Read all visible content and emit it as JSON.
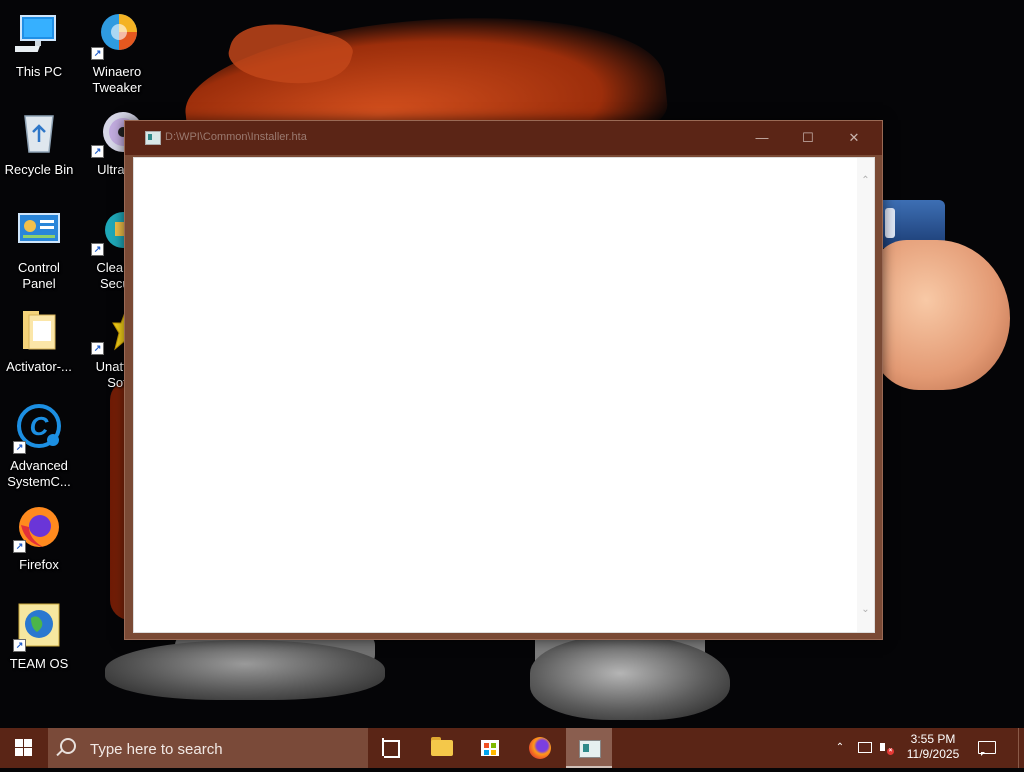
{
  "desktop": {
    "icons": [
      {
        "label_lines": [
          "This PC",
          ""
        ],
        "icon": "computer-icon"
      },
      {
        "label_lines": [
          "Winaero",
          "Tweaker"
        ],
        "icon": "winaero-tweaker-icon"
      },
      {
        "label_lines": [
          "Recycle Bin",
          ""
        ],
        "icon": "recycle-bin-icon"
      },
      {
        "label_lines": [
          "UltraIS",
          ""
        ],
        "icon": "disc-icon"
      },
      {
        "label_lines": [
          "Control",
          "Panel"
        ],
        "icon": "control-panel-icon"
      },
      {
        "label_lines": [
          "Clean I",
          "Secur"
        ],
        "icon": "clean-security-icon"
      },
      {
        "label_lines": [
          "Activator-...",
          ""
        ],
        "icon": "folder-icon"
      },
      {
        "label_lines": [
          "Unatter",
          "Sof"
        ],
        "icon": "star-icon"
      },
      {
        "label_lines": [
          "Advanced",
          "SystemC..."
        ],
        "icon": "advanced-systemcare-icon"
      },
      {
        "label_lines": [
          "Firefox",
          ""
        ],
        "icon": "firefox-icon"
      },
      {
        "label_lines": [
          "TEAM OS",
          ""
        ],
        "icon": "globe-icon"
      }
    ]
  },
  "window": {
    "title": "D:\\WPI\\Common\\Installer.hta",
    "minimize_glyph": "—",
    "maximize_glyph": "☐",
    "close_glyph": "✕",
    "scroll_up_glyph": "⌃",
    "scroll_down_glyph": "⌄"
  },
  "taskbar": {
    "search_placeholder": "Type here to search",
    "tray_chevron": "⌃",
    "clock_time": "3:55 PM",
    "clock_date": "11/9/2025"
  },
  "colors": {
    "taskbar": "#5a2516",
    "titlebar": "#5b2516",
    "search_box": "#7a4a39"
  }
}
